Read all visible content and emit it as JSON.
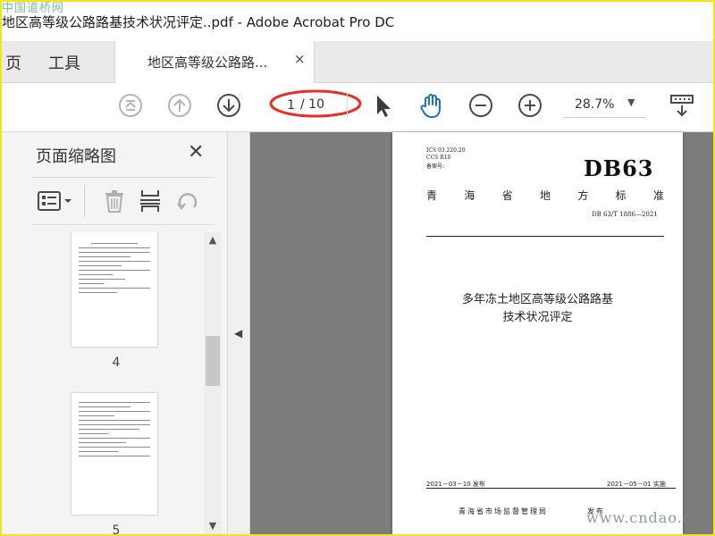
{
  "watermark_top": "中国道桥网",
  "watermark_bottom": "www.cndao.c",
  "window": {
    "title": "地区高等级公路路基技术状况评定..pdf - Adobe Acrobat Pro DC"
  },
  "tabs": {
    "home": "页",
    "tools": "工具",
    "document": "地区高等级公路路...",
    "close_glyph": "×"
  },
  "toolbar": {
    "current_page": "1",
    "total_pages": "/ 10",
    "zoom": "28.7%",
    "zoom_caret": "▼",
    "icons": [
      "first-page-icon",
      "prev-page-icon",
      "next-page-icon",
      "select-cursor-icon",
      "hand-tool-icon",
      "zoom-out-icon",
      "zoom-in-icon",
      "page-display-icon"
    ]
  },
  "sidebar": {
    "title": "页面缩略图",
    "close_glyph": "✕",
    "tools": [
      "thumbnail-options-icon",
      "delete-page-icon",
      "insert-page-icon",
      "rotate-page-icon"
    ],
    "thumbnails": [
      {
        "page": "4"
      },
      {
        "page": "5"
      }
    ],
    "scroll_up": "▲",
    "scroll_down": "▼",
    "collapse_glyph": "◀"
  },
  "document_page": {
    "ics": "ICS 03.220.20",
    "ccs": "CCS R10",
    "filing": "备案号:",
    "code": "DB63",
    "standard_chars": [
      "青",
      "海",
      "省",
      "地",
      "方",
      "标",
      "准"
    ],
    "number": "DB 63/T 1886—2021",
    "title_line1": "多年冻土地区高等级公路路基",
    "title_line2": "技术状况评定",
    "issue_date": "2021－03－10 发布",
    "impl_date": "2021－05－01 实施",
    "issuer": "青海省市场监督管理局",
    "issuer_tag": "发布"
  },
  "colors": {
    "frame_border": "#f2e41a",
    "accent_blue": "#1a73c8",
    "annotation_red": "#e0312a"
  }
}
